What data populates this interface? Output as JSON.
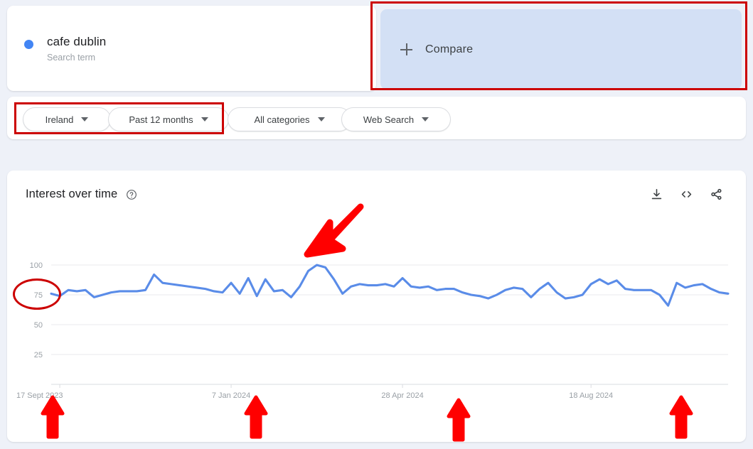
{
  "search_term": {
    "label": "cafe dublin",
    "sublabel": "Search term",
    "dot_color": "#4285f4"
  },
  "compare": {
    "label": "Compare",
    "plus_icon": "plus-icon",
    "background": "#d3e0f5"
  },
  "filters": [
    {
      "id": "region",
      "label": "Ireland",
      "caret": "chevron-down-icon"
    },
    {
      "id": "time",
      "label": "Past 12 months",
      "caret": "chevron-down-icon"
    },
    {
      "id": "category",
      "label": "All categories",
      "caret": "chevron-down-icon"
    },
    {
      "id": "type",
      "label": "Web Search",
      "caret": "chevron-down-icon"
    }
  ],
  "chart_panel": {
    "title": "Interest over time",
    "help_icon": "help-circle-icon",
    "actions": [
      {
        "name": "download-icon",
        "title": "Download"
      },
      {
        "name": "embed-code-icon",
        "title": "Embed"
      },
      {
        "name": "share-icon",
        "title": "Share"
      }
    ]
  },
  "annotations": {
    "compare_box_color": "#cc0000",
    "pills_box_color": "#cc0000",
    "ellipse_target": "75",
    "arrow_color": "#ff0000",
    "down_arrow_points_to": "chart peak near 100",
    "up_arrows_point_to": [
      "17 Sept 2023",
      "7 Jan 2024",
      "28 Apr 2024",
      "18 Aug 2024"
    ]
  },
  "chart_data": {
    "type": "line",
    "title": "Interest over time",
    "xlabel": "",
    "ylabel": "",
    "ylim": [
      0,
      110
    ],
    "yticks": [
      25,
      50,
      75,
      100
    ],
    "grid": true,
    "legend": "none",
    "line_color": "#5a8ce8",
    "series": [
      {
        "name": "cafe dublin",
        "values": [
          76,
          74,
          79,
          78,
          79,
          73,
          75,
          77,
          78,
          78,
          78,
          79,
          92,
          85,
          84,
          83,
          82,
          81,
          80,
          78,
          77,
          85,
          76,
          89,
          74,
          88,
          78,
          79,
          73,
          82,
          95,
          100,
          98,
          88,
          76,
          82,
          84,
          83,
          83,
          84,
          82,
          89,
          82,
          81,
          82,
          79,
          80,
          80,
          77,
          75,
          74,
          72,
          75,
          79,
          81,
          80,
          73,
          80,
          85,
          77,
          72,
          73,
          75,
          84,
          88,
          84,
          87,
          80,
          79,
          79,
          79,
          75,
          66,
          85,
          81,
          83,
          84,
          80,
          77,
          76
        ]
      }
    ],
    "xticks": [
      {
        "index": 1,
        "label": "17 Sept 2023"
      },
      {
        "index": 21,
        "label": "7 Jan 2024"
      },
      {
        "index": 41,
        "label": "28 Apr 2024"
      },
      {
        "index": 63,
        "label": "18 Aug 2024"
      }
    ]
  }
}
